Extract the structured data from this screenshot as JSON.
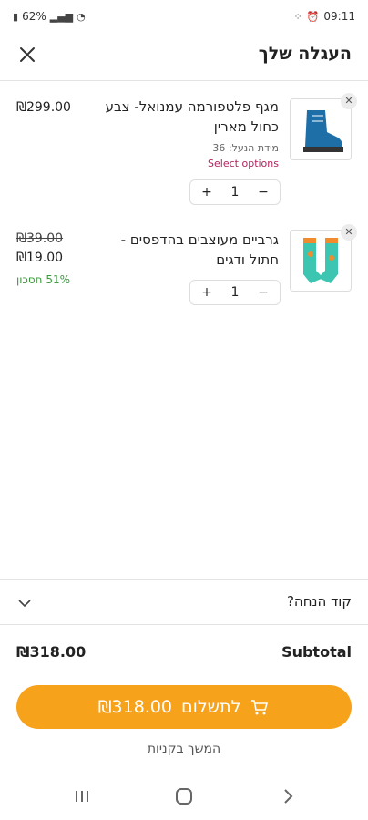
{
  "status_bar": {
    "battery": "62%",
    "time": "09:11"
  },
  "header": {
    "title": "העגלה שלך",
    "close_icon": "close-icon"
  },
  "items": [
    {
      "name": "מגף פלטפורמה עמנואל- צבע כחול מארין",
      "meta": "מידת הנעל: 36",
      "options_link": "Select options",
      "price": "₪299.00",
      "quantity": "1",
      "image_icon": "boot-image"
    },
    {
      "name": "גרביים מעוצבים בהדפסים - חתול ודגים",
      "price_old": "₪39.00",
      "price": "₪19.00",
      "savings": "51% חסכון",
      "quantity": "1",
      "image_icon": "socks-image"
    }
  ],
  "coupon": {
    "label": "קוד הנחה?"
  },
  "subtotal": {
    "label": "Subtotal",
    "value": "₪318.00"
  },
  "checkout": {
    "label": "לתשלום",
    "amount": "₪318.00"
  },
  "continue_shopping": "המשך בקניות",
  "colors": {
    "accent": "#f7a21b",
    "options_link": "#b0245e",
    "savings": "#3a9a3a"
  }
}
